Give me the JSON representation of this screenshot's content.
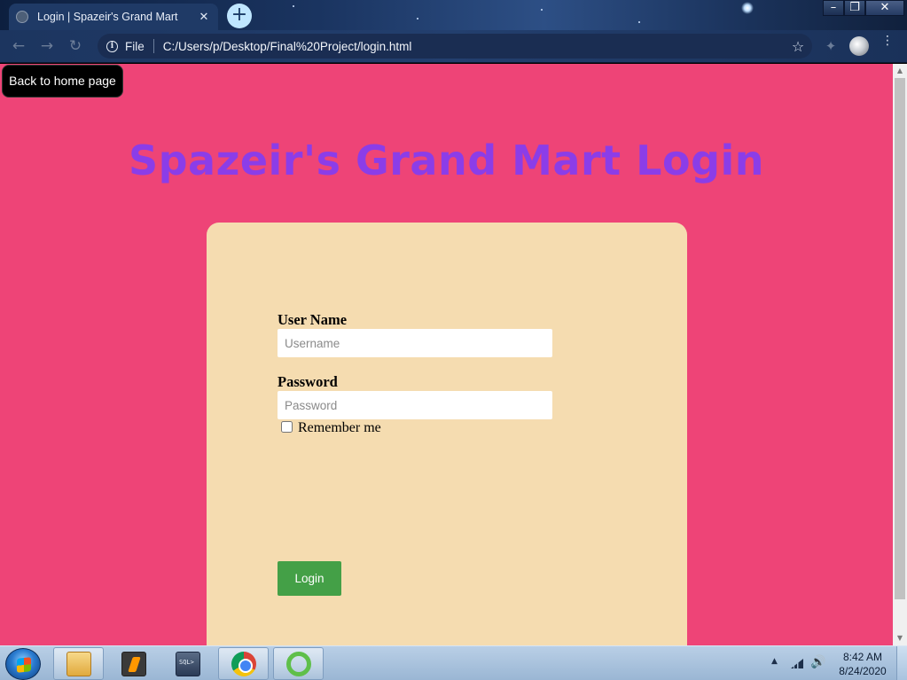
{
  "browser": {
    "tab_title": "Login | Spazeir's Grand Mart",
    "tab_close": "✕",
    "new_tab": "+",
    "window": {
      "minimize": "–",
      "maximize": "❐",
      "close": "✕"
    },
    "nav": {
      "back": "←",
      "forward": "→",
      "reload": "↻"
    },
    "scheme_label": "File",
    "url": "C:/Users/p/Desktop/Final%20Project/login.html",
    "bookmark_star": "☆",
    "extension_icon": "✦",
    "menu_icon": "⋮"
  },
  "page": {
    "back_button": "Back to home page",
    "title": "Spazeir's Grand Mart Login",
    "form": {
      "username_label": "User Name",
      "username_placeholder": "Username",
      "password_label": "Password",
      "password_placeholder": "Password",
      "remember_label": "Remember me",
      "remember_checked": false,
      "submit_label": "Login"
    }
  },
  "scrollbar": {
    "up": "▲",
    "down": "▼"
  },
  "taskbar": {
    "items": [
      "file-explorer",
      "sublime-text",
      "sql-plus",
      "chrome",
      "green-app"
    ],
    "tray_up": "▲",
    "volume": "🔊",
    "time": "8:42 AM",
    "date": "8/24/2020"
  },
  "colors": {
    "page_background": "#ee4477",
    "title_color": "#8b3de8",
    "card_background": "#f5dcb0",
    "login_button": "#44a047",
    "back_button": "#000000"
  }
}
